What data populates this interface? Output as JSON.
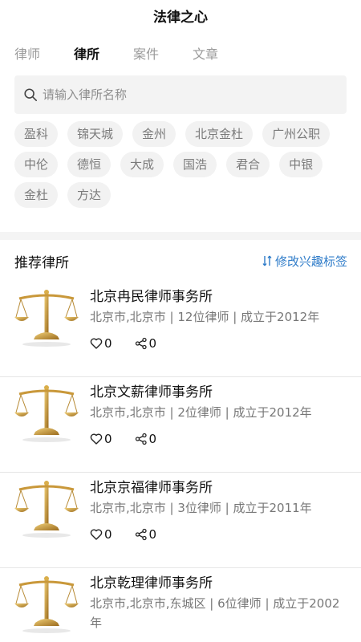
{
  "header": {
    "title": "法律之心"
  },
  "tabs": [
    {
      "label": "律师",
      "active": false
    },
    {
      "label": "律所",
      "active": true
    },
    {
      "label": "案件",
      "active": false
    },
    {
      "label": "文章",
      "active": false
    }
  ],
  "search": {
    "placeholder": "请输入律所名称",
    "icon": "search-icon"
  },
  "tags": [
    "盈科",
    "锦天城",
    "金州",
    "北京金杜",
    "广州公职",
    "中伦",
    "德恒",
    "大成",
    "国浩",
    "君合",
    "中银",
    "金杜",
    "方达"
  ],
  "section": {
    "title": "推荐律所",
    "action_label": "修改兴趣标签",
    "action_icon": "sort-arrows-icon",
    "accent_color": "#2f7cc9"
  },
  "firms": [
    {
      "name": "北京冉民律师事务所",
      "meta": "北京市,北京市 | 12位律师 | 成立于2012年",
      "likes": "0",
      "shares": "0",
      "image": "scales-of-justice"
    },
    {
      "name": "北京文薪律师事务所",
      "meta": "北京市,北京市 | 2位律师 | 成立于2012年",
      "likes": "0",
      "shares": "0",
      "image": "scales-of-justice"
    },
    {
      "name": "北京京福律师事务所",
      "meta": "北京市,北京市 | 3位律师 | 成立于2011年",
      "likes": "0",
      "shares": "0",
      "image": "scales-of-justice"
    },
    {
      "name": "北京乾理律师事务所",
      "meta": "北京市,北京市,东城区 | 6位律师 | 成立于2002年",
      "likes": "0",
      "shares": "0",
      "image": "scales-of-justice"
    }
  ]
}
